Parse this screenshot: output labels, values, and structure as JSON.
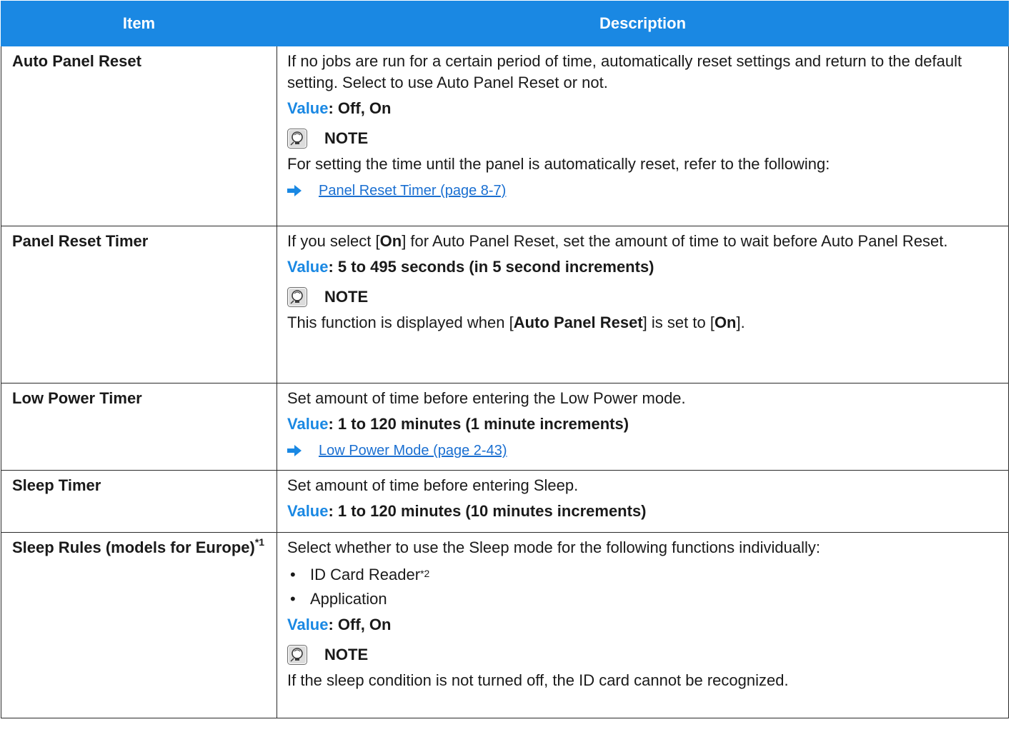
{
  "table": {
    "headers": {
      "item": "Item",
      "description": "Description"
    },
    "value_label": "Value",
    "note_label": "NOTE",
    "rows": {
      "auto_panel_reset": {
        "item": "Auto Panel Reset",
        "text": "If no jobs are run for a certain period of time, automatically reset settings and return to the default setting. Select to use Auto Panel Reset or not.",
        "value": ": Off, On",
        "note": "For setting the time until the panel is automatically reset, refer to the following:",
        "link": "Panel Reset Timer (page 8-7)"
      },
      "panel_reset_timer": {
        "item": "Panel Reset Timer",
        "text_before": "If you select [",
        "text_bold": "On",
        "text_after": "] for Auto Panel Reset, set the amount of time to wait before Auto Panel Reset.",
        "value": ": 5 to 495 seconds (in 5 second increments)",
        "note_a": "This function is displayed when [",
        "note_b": "Auto Panel Reset",
        "note_c": "] is set to [",
        "note_d": "On",
        "note_e": "]."
      },
      "low_power_timer": {
        "item": "Low Power Timer",
        "text": "Set amount of time before entering the Low Power mode.",
        "value": ": 1 to 120 minutes (1 minute increments)",
        "link": "Low Power Mode (page 2-43)"
      },
      "sleep_timer": {
        "item": "Sleep Timer",
        "text": "Set amount of time before entering Sleep.",
        "value": ": 1 to 120 minutes (10 minutes increments)"
      },
      "sleep_rules": {
        "item": "Sleep Rules (models for Europe)",
        "item_sup": "*1",
        "text": "Select whether to use the Sleep mode for the following functions individually:",
        "bullet_1": "ID Card Reader",
        "bullet_1_sup": "*2",
        "bullet_2": "Application",
        "bullet_char": "•",
        "value": ": Off, On",
        "note": "If the sleep condition is not turned off, the ID card cannot be recognized."
      }
    }
  },
  "colors": {
    "header_bg": "#1a88e3",
    "value_label": "#1a88e3",
    "link": "#1a6fd1"
  },
  "icons": {
    "note": "note-bulb-icon",
    "arrow": "arrow-right-icon"
  }
}
